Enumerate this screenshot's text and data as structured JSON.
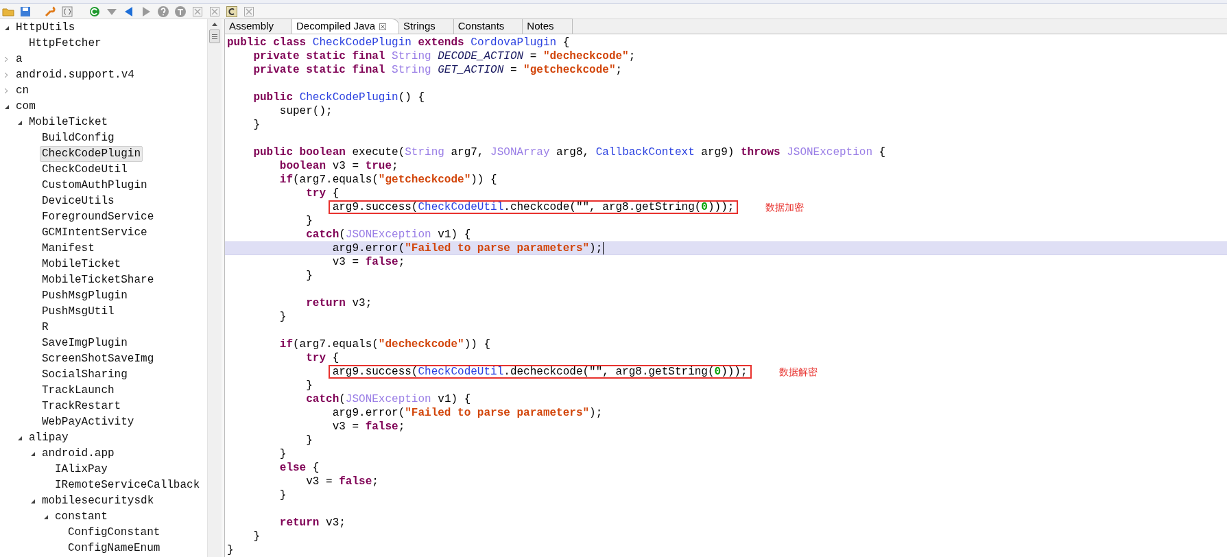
{
  "tree": [
    {
      "label": "HttpUtils",
      "expanded": true,
      "selected": false,
      "children": [
        {
          "label": "HttpFetcher",
          "selected": false
        }
      ]
    },
    {
      "label": "a",
      "expanded": false,
      "selected": false
    },
    {
      "label": "android.support.v4",
      "expanded": false,
      "selected": false
    },
    {
      "label": "cn",
      "expanded": false,
      "selected": false
    },
    {
      "label": "com",
      "expanded": true,
      "selected": false,
      "children": [
        {
          "label": "MobileTicket",
          "expanded": true,
          "selected": false,
          "children": [
            {
              "label": "BuildConfig",
              "selected": false
            },
            {
              "label": "CheckCodePlugin",
              "selected": true
            },
            {
              "label": "CheckCodeUtil",
              "selected": false
            },
            {
              "label": "CustomAuthPlugin",
              "selected": false
            },
            {
              "label": "DeviceUtils",
              "selected": false
            },
            {
              "label": "ForegroundService",
              "selected": false
            },
            {
              "label": "GCMIntentService",
              "selected": false
            },
            {
              "label": "Manifest",
              "selected": false
            },
            {
              "label": "MobileTicket",
              "selected": false
            },
            {
              "label": "MobileTicketShare",
              "selected": false
            },
            {
              "label": "PushMsgPlugin",
              "selected": false
            },
            {
              "label": "PushMsgUtil",
              "selected": false
            },
            {
              "label": "R",
              "selected": false
            },
            {
              "label": "SaveImgPlugin",
              "selected": false
            },
            {
              "label": "ScreenShotSaveImg",
              "selected": false
            },
            {
              "label": "SocialSharing",
              "selected": false
            },
            {
              "label": "TrackLaunch",
              "selected": false
            },
            {
              "label": "TrackRestart",
              "selected": false
            },
            {
              "label": "WebPayActivity",
              "selected": false
            }
          ]
        },
        {
          "label": "alipay",
          "expanded": true,
          "selected": false,
          "children": [
            {
              "label": "android.app",
              "expanded": true,
              "selected": false,
              "children": [
                {
                  "label": "IAlixPay",
                  "selected": false
                },
                {
                  "label": "IRemoteServiceCallback",
                  "selected": false
                }
              ]
            },
            {
              "label": "mobilesecuritysdk",
              "expanded": true,
              "selected": false,
              "children": [
                {
                  "label": "constant",
                  "expanded": true,
                  "selected": false,
                  "children": [
                    {
                      "label": "ConfigConstant",
                      "selected": false
                    },
                    {
                      "label": "ConfigNameEnum",
                      "selected": false
                    }
                  ]
                }
              ]
            }
          ]
        }
      ]
    }
  ],
  "tabs": [
    {
      "label": "Assembly",
      "selected": false
    },
    {
      "label": "Decompiled Java",
      "selected": true
    },
    {
      "label": "Strings",
      "selected": false
    },
    {
      "label": "Constants",
      "selected": false
    },
    {
      "label": "Notes",
      "selected": false
    }
  ],
  "code": [
    {
      "kind": "code",
      "current": false,
      "tokens": [
        {
          "kind": "kw",
          "text": "public class "
        },
        {
          "kind": "class",
          "text": "CheckCodePlugin"
        },
        {
          "kind": "kw",
          "text": " extends "
        },
        {
          "kind": "class",
          "text": "CordovaPlugin"
        },
        {
          "kind": "plain",
          "text": " {"
        }
      ]
    },
    {
      "kind": "code",
      "current": false,
      "tokens": [
        {
          "kind": "kw",
          "text": "    private static final "
        },
        {
          "kind": "type",
          "text": "String"
        },
        {
          "kind": "field",
          "text": " DECODE_ACTION"
        },
        {
          "kind": "plain",
          "text": " = "
        },
        {
          "kind": "str",
          "text": "\"decheckcode\""
        },
        {
          "kind": "plain",
          "text": ";"
        }
      ]
    },
    {
      "kind": "code",
      "current": false,
      "tokens": [
        {
          "kind": "kw",
          "text": "    private static final "
        },
        {
          "kind": "type",
          "text": "String"
        },
        {
          "kind": "field",
          "text": " GET_ACTION"
        },
        {
          "kind": "plain",
          "text": " = "
        },
        {
          "kind": "str",
          "text": "\"getcheckcode\""
        },
        {
          "kind": "plain",
          "text": ";"
        }
      ]
    },
    {
      "kind": "blank",
      "current": false
    },
    {
      "kind": "code",
      "current": false,
      "tokens": [
        {
          "kind": "kw",
          "text": "    public "
        },
        {
          "kind": "class",
          "text": "CheckCodePlugin"
        },
        {
          "kind": "plain",
          "text": "() {"
        }
      ]
    },
    {
      "kind": "code",
      "current": false,
      "tokens": [
        {
          "kind": "plain",
          "text": "        super();"
        }
      ]
    },
    {
      "kind": "code",
      "current": false,
      "tokens": [
        {
          "kind": "plain",
          "text": "    }"
        }
      ]
    },
    {
      "kind": "blank",
      "current": false
    },
    {
      "kind": "code",
      "current": false,
      "tokens": [
        {
          "kind": "kw",
          "text": "    public boolean "
        },
        {
          "kind": "plain",
          "text": "execute("
        },
        {
          "kind": "type",
          "text": "String"
        },
        {
          "kind": "plain",
          "text": " arg7, "
        },
        {
          "kind": "type",
          "text": "JSONArray"
        },
        {
          "kind": "plain",
          "text": " arg8, "
        },
        {
          "kind": "class",
          "text": "CallbackContext"
        },
        {
          "kind": "plain",
          "text": " arg9) "
        },
        {
          "kind": "kw",
          "text": "throws "
        },
        {
          "kind": "type",
          "text": "JSONException"
        },
        {
          "kind": "plain",
          "text": " {"
        }
      ]
    },
    {
      "kind": "code",
      "current": false,
      "tokens": [
        {
          "kind": "kw",
          "text": "        boolean "
        },
        {
          "kind": "plain",
          "text": "v3 = "
        },
        {
          "kind": "kw",
          "text": "true"
        },
        {
          "kind": "plain",
          "text": ";"
        }
      ]
    },
    {
      "kind": "code",
      "current": false,
      "tokens": [
        {
          "kind": "kw",
          "text": "        if"
        },
        {
          "kind": "plain",
          "text": "(arg7.equals("
        },
        {
          "kind": "str",
          "text": "\"getcheckcode\""
        },
        {
          "kind": "plain",
          "text": ")) {"
        }
      ]
    },
    {
      "kind": "code",
      "current": false,
      "tokens": [
        {
          "kind": "kw",
          "text": "            try"
        },
        {
          "kind": "plain",
          "text": " {"
        }
      ]
    },
    {
      "kind": "code",
      "current": false,
      "annotation": "数据加密",
      "tokens": [
        {
          "kind": "plain",
          "text": "                arg9.success("
        },
        {
          "kind": "class",
          "text": "CheckCodeUtil"
        },
        {
          "kind": "plain",
          "text": ".checkcode(\"\", arg8.getString("
        },
        {
          "kind": "num",
          "text": "0"
        },
        {
          "kind": "plain",
          "text": ")));"
        }
      ]
    },
    {
      "kind": "code",
      "current": false,
      "tokens": [
        {
          "kind": "plain",
          "text": "            }"
        }
      ]
    },
    {
      "kind": "code",
      "current": false,
      "tokens": [
        {
          "kind": "kw",
          "text": "            catch"
        },
        {
          "kind": "plain",
          "text": "("
        },
        {
          "kind": "type",
          "text": "JSONException"
        },
        {
          "kind": "plain",
          "text": " v1) {"
        }
      ]
    },
    {
      "kind": "code",
      "current": true,
      "tokens": [
        {
          "kind": "plain",
          "text": "                arg9.error("
        },
        {
          "kind": "str",
          "text": "\"Failed to parse parameters\""
        },
        {
          "kind": "plain",
          "text": ");"
        }
      ]
    },
    {
      "kind": "code",
      "current": false,
      "tokens": [
        {
          "kind": "plain",
          "text": "                v3 = "
        },
        {
          "kind": "kw",
          "text": "false"
        },
        {
          "kind": "plain",
          "text": ";"
        }
      ]
    },
    {
      "kind": "code",
      "current": false,
      "tokens": [
        {
          "kind": "plain",
          "text": "            }"
        }
      ]
    },
    {
      "kind": "blank",
      "current": false
    },
    {
      "kind": "code",
      "current": false,
      "tokens": [
        {
          "kind": "kw",
          "text": "            return "
        },
        {
          "kind": "plain",
          "text": "v3;"
        }
      ]
    },
    {
      "kind": "code",
      "current": false,
      "tokens": [
        {
          "kind": "plain",
          "text": "        }"
        }
      ]
    },
    {
      "kind": "blank",
      "current": false
    },
    {
      "kind": "code",
      "current": false,
      "tokens": [
        {
          "kind": "kw",
          "text": "        if"
        },
        {
          "kind": "plain",
          "text": "(arg7.equals("
        },
        {
          "kind": "str",
          "text": "\"decheckcode\""
        },
        {
          "kind": "plain",
          "text": ")) {"
        }
      ]
    },
    {
      "kind": "code",
      "current": false,
      "tokens": [
        {
          "kind": "kw",
          "text": "            try"
        },
        {
          "kind": "plain",
          "text": " {"
        }
      ]
    },
    {
      "kind": "code",
      "current": false,
      "annotation": "数据解密",
      "tokens": [
        {
          "kind": "plain",
          "text": "                arg9.success("
        },
        {
          "kind": "class",
          "text": "CheckCodeUtil"
        },
        {
          "kind": "plain",
          "text": ".decheckcode(\"\", arg8.getString("
        },
        {
          "kind": "num",
          "text": "0"
        },
        {
          "kind": "plain",
          "text": ")));"
        }
      ]
    },
    {
      "kind": "code",
      "current": false,
      "tokens": [
        {
          "kind": "plain",
          "text": "            }"
        }
      ]
    },
    {
      "kind": "code",
      "current": false,
      "tokens": [
        {
          "kind": "kw",
          "text": "            catch"
        },
        {
          "kind": "plain",
          "text": "("
        },
        {
          "kind": "type",
          "text": "JSONException"
        },
        {
          "kind": "plain",
          "text": " v1) {"
        }
      ]
    },
    {
      "kind": "code",
      "current": false,
      "tokens": [
        {
          "kind": "plain",
          "text": "                arg9.error("
        },
        {
          "kind": "str",
          "text": "\"Failed to parse parameters\""
        },
        {
          "kind": "plain",
          "text": ");"
        }
      ]
    },
    {
      "kind": "code",
      "current": false,
      "tokens": [
        {
          "kind": "plain",
          "text": "                v3 = "
        },
        {
          "kind": "kw",
          "text": "false"
        },
        {
          "kind": "plain",
          "text": ";"
        }
      ]
    },
    {
      "kind": "code",
      "current": false,
      "tokens": [
        {
          "kind": "plain",
          "text": "            }"
        }
      ]
    },
    {
      "kind": "code",
      "current": false,
      "tokens": [
        {
          "kind": "plain",
          "text": "        }"
        }
      ]
    },
    {
      "kind": "code",
      "current": false,
      "tokens": [
        {
          "kind": "kw",
          "text": "        else"
        },
        {
          "kind": "plain",
          "text": " {"
        }
      ]
    },
    {
      "kind": "code",
      "current": false,
      "tokens": [
        {
          "kind": "plain",
          "text": "            v3 = "
        },
        {
          "kind": "kw",
          "text": "false"
        },
        {
          "kind": "plain",
          "text": ";"
        }
      ]
    },
    {
      "kind": "code",
      "current": false,
      "tokens": [
        {
          "kind": "plain",
          "text": "        }"
        }
      ]
    },
    {
      "kind": "blank",
      "current": false
    },
    {
      "kind": "code",
      "current": false,
      "tokens": [
        {
          "kind": "kw",
          "text": "        return "
        },
        {
          "kind": "plain",
          "text": "v3;"
        }
      ]
    },
    {
      "kind": "code",
      "current": false,
      "tokens": [
        {
          "kind": "plain",
          "text": "    }"
        }
      ]
    },
    {
      "kind": "code",
      "current": false,
      "tokens": [
        {
          "kind": "plain",
          "text": "}"
        }
      ]
    }
  ]
}
